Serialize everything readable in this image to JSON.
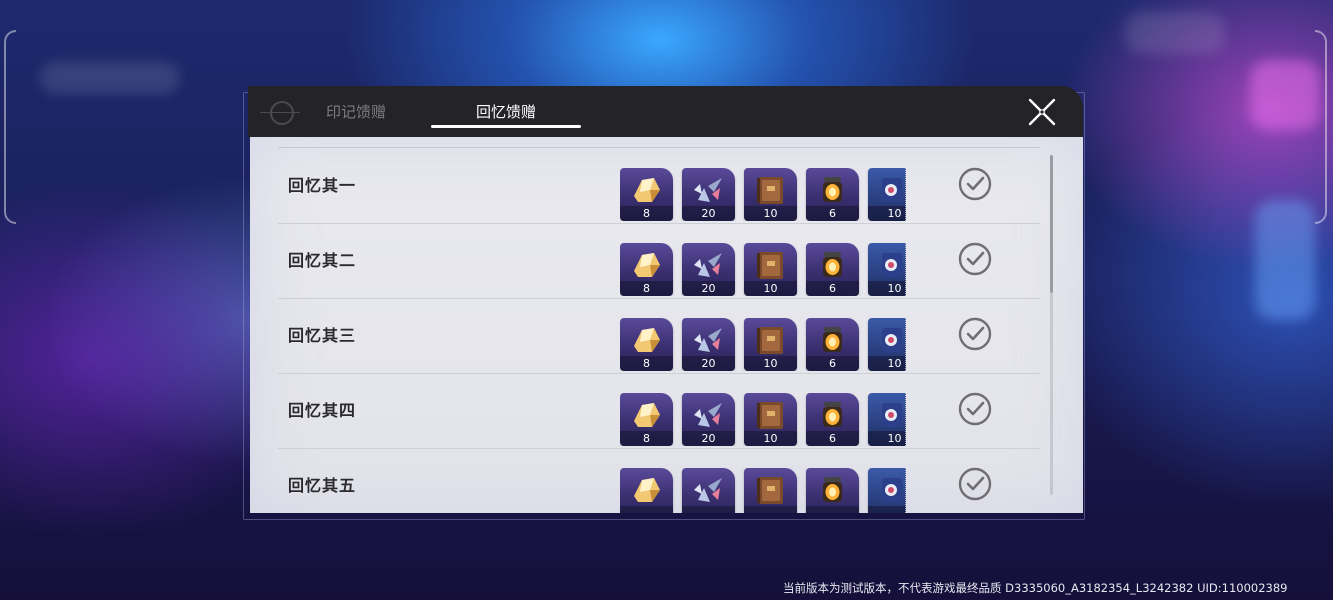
{
  "tabs": [
    {
      "label": "印记馈赠",
      "active": false
    },
    {
      "label": "回忆馈赠",
      "active": true
    }
  ],
  "close_icon": "close-icon",
  "rewards": [
    {
      "title": "回忆其一",
      "items": [
        {
          "icon": "gold-ore-icon",
          "qty": "8"
        },
        {
          "icon": "crystal-shard-icon",
          "qty": "20"
        },
        {
          "icon": "book-icon",
          "qty": "10"
        },
        {
          "icon": "lantern-icon",
          "qty": "6"
        },
        {
          "icon": "blue-material-icon",
          "qty": "10"
        }
      ],
      "claimed": true
    },
    {
      "title": "回忆其二",
      "items": [
        {
          "icon": "gold-ore-icon",
          "qty": "8"
        },
        {
          "icon": "crystal-shard-icon",
          "qty": "20"
        },
        {
          "icon": "book-icon",
          "qty": "10"
        },
        {
          "icon": "lantern-icon",
          "qty": "6"
        },
        {
          "icon": "blue-material-icon",
          "qty": "10"
        }
      ],
      "claimed": true
    },
    {
      "title": "回忆其三",
      "items": [
        {
          "icon": "gold-ore-icon",
          "qty": "8"
        },
        {
          "icon": "crystal-shard-icon",
          "qty": "20"
        },
        {
          "icon": "book-icon",
          "qty": "10"
        },
        {
          "icon": "lantern-icon",
          "qty": "6"
        },
        {
          "icon": "blue-material-icon",
          "qty": "10"
        }
      ],
      "claimed": true
    },
    {
      "title": "回忆其四",
      "items": [
        {
          "icon": "gold-ore-icon",
          "qty": "8"
        },
        {
          "icon": "crystal-shard-icon",
          "qty": "20"
        },
        {
          "icon": "book-icon",
          "qty": "10"
        },
        {
          "icon": "lantern-icon",
          "qty": "6"
        },
        {
          "icon": "blue-material-icon",
          "qty": "10"
        }
      ],
      "claimed": true
    },
    {
      "title": "回忆其五",
      "items": [
        {
          "icon": "gold-ore-icon",
          "qty": ""
        },
        {
          "icon": "crystal-shard-icon",
          "qty": ""
        },
        {
          "icon": "book-icon",
          "qty": ""
        },
        {
          "icon": "lantern-icon",
          "qty": ""
        },
        {
          "icon": "blue-material-icon",
          "qty": ""
        }
      ],
      "claimed": true
    }
  ],
  "footer_note": "当前版本为测试版本，不代表游戏最终品质  D3335060_A3182354_L3242382  UID:110002389",
  "colors": {
    "header_bg": "#242428",
    "tab_active": "#ffffff",
    "tab_inactive": "#7b7b80",
    "panel_bg": "#e6e6ec",
    "item_purple": "#3a2f70",
    "check_gray": "#6e6e74"
  }
}
